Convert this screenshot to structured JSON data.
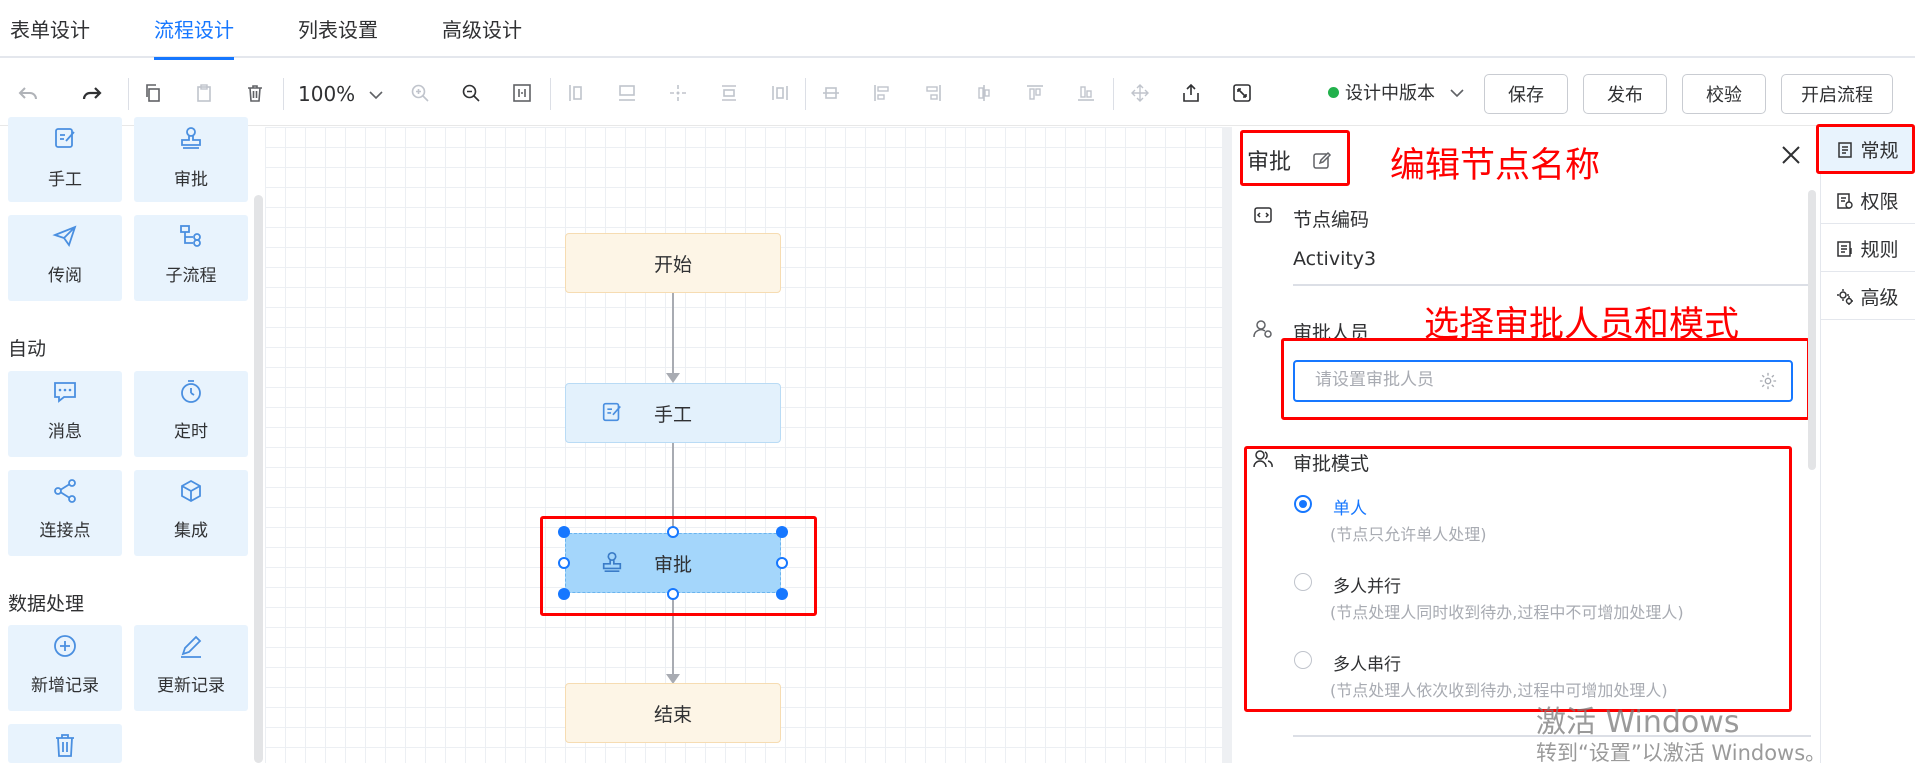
{
  "tabs": [
    "表单设计",
    "流程设计",
    "列表设置",
    "高级设计"
  ],
  "active_tab": "流程设计",
  "toolbar": {
    "zoom": "100%",
    "version": "设计中版本",
    "buttons": [
      "保存",
      "发布",
      "校验",
      "开启流程"
    ],
    "status_color": "#22b14c"
  },
  "palette": {
    "items_top": [
      {
        "label": "手工",
        "icon": "edit-doc-icon"
      },
      {
        "label": "审批",
        "icon": "stamp-icon"
      },
      {
        "label": "传阅",
        "icon": "send-icon"
      },
      {
        "label": "子流程",
        "icon": "subprocess-icon"
      }
    ],
    "group_auto": "自动",
    "items_auto": [
      {
        "label": "消息",
        "icon": "message-icon"
      },
      {
        "label": "定时",
        "icon": "timer-icon"
      },
      {
        "label": "连接点",
        "icon": "share-icon"
      },
      {
        "label": "集成",
        "icon": "cube-icon"
      }
    ],
    "group_data": "数据处理",
    "items_data": [
      {
        "label": "新增记录",
        "icon": "plus-circle-icon"
      },
      {
        "label": "更新记录",
        "icon": "pen-icon"
      }
    ]
  },
  "flow": {
    "nodes": [
      "开始",
      "手工",
      "审批",
      "结束"
    ]
  },
  "panel": {
    "title": "审批",
    "code_label": "节点编码",
    "code_value": "Activity3",
    "approver_label": "审批人员",
    "approver_placeholder": "请设置审批人员",
    "mode_label": "审批模式",
    "modes": [
      {
        "name": "单人",
        "desc": "(节点只允许单人处理)",
        "selected": true
      },
      {
        "name": "多人并行",
        "desc": "(节点处理人同时收到待办,过程中不可增加处理人)",
        "selected": false
      },
      {
        "name": "多人串行",
        "desc": "(节点处理人依次收到待办,过程中可增加处理人)",
        "selected": false
      }
    ]
  },
  "side_tabs": [
    "常规",
    "权限",
    "规则",
    "高级"
  ],
  "annotations": {
    "edit_name": "编辑节点名称",
    "select_approver": "选择审批人员和模式"
  },
  "watermark": {
    "line1": "激活 Windows",
    "line2": "转到“设置”以激活 Windows。"
  },
  "colors": {
    "accent": "#1677ff",
    "annotation_red": "#ff0000"
  }
}
